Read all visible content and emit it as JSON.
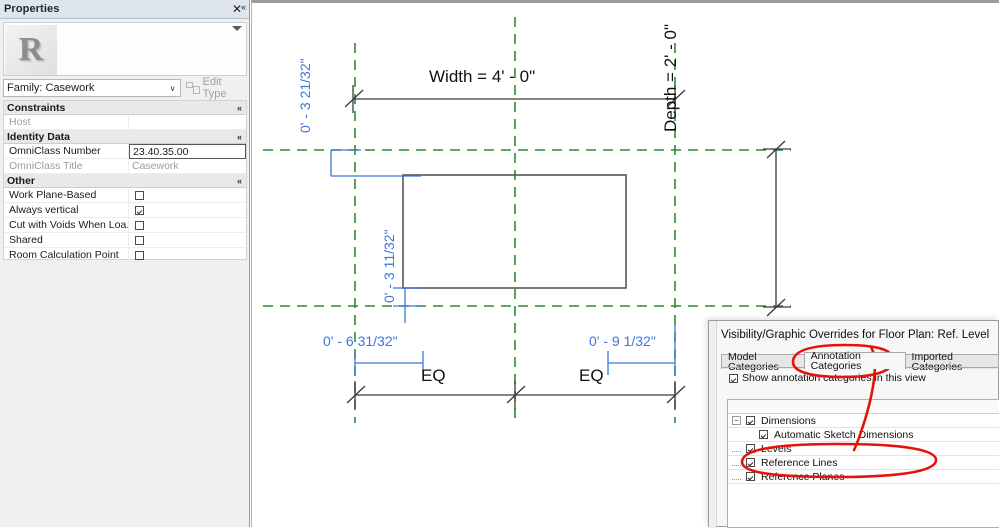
{
  "properties_panel": {
    "title": "Properties",
    "close_label": "✕",
    "collapse_label": "«",
    "thumbnail_letter": "R",
    "family_value": "Family: Casework",
    "family_arrow": "∨",
    "edit_type_label": "Edit Type",
    "groups": [
      {
        "name": "Constraints",
        "chevron": "«",
        "rows": [
          {
            "label": "Host",
            "value": "",
            "type": "text",
            "dim": true,
            "editing": false
          }
        ]
      },
      {
        "name": "Identity Data",
        "chevron": "«",
        "rows": [
          {
            "label": "OmniClass Number",
            "value": "23.40.35.00",
            "type": "text",
            "dim": false,
            "editing": true
          },
          {
            "label": "OmniClass Title",
            "value": "Casework",
            "type": "text",
            "dim": true,
            "editing": false
          }
        ]
      },
      {
        "name": "Other",
        "chevron": "«",
        "rows": [
          {
            "label": "Work Plane-Based",
            "value": "",
            "type": "checkbox",
            "checked": false,
            "dim": false
          },
          {
            "label": "Always vertical",
            "value": "",
            "type": "checkbox",
            "checked": true,
            "dim": false
          },
          {
            "label": "Cut with Voids When Loa...",
            "value": "",
            "type": "checkbox",
            "checked": false,
            "dim": false
          },
          {
            "label": "Shared",
            "value": "",
            "type": "checkbox",
            "checked": false,
            "dim": false
          },
          {
            "label": "Room Calculation Point",
            "value": "",
            "type": "checkbox",
            "checked": false,
            "dim": false
          }
        ]
      }
    ]
  },
  "canvas": {
    "width_dimension": "Width = 4' - 0\"",
    "depth_dimension": "Depth = 2' - 0\"",
    "top_left_offset": "0' - 3 21/32\"",
    "bottom_left_offset": "0' - 3 11/32\"",
    "bottom_dim_left": "0' - 6 31/32\"",
    "bottom_dim_right": "0' - 9 1/32\"",
    "eq_left": "EQ",
    "eq_right": "EQ",
    "colors": {
      "reference_plane": "#2f8a32",
      "sketch_dimension": "#3c78d8",
      "permanent_dimension": "#3a3a3a",
      "geometry": "#565656",
      "annotation_red": "#e8120c"
    }
  },
  "vg_dialog": {
    "title": "Visibility/Graphic Overrides for Floor Plan: Ref. Level",
    "tabs": [
      {
        "label": "Model Categories",
        "selected": false
      },
      {
        "label": "Annotation Categories",
        "selected": true
      },
      {
        "label": "Imported Categories",
        "selected": false
      }
    ],
    "show_annotation_label": "Show annotation categories in this view",
    "show_annotation_checked": true,
    "tree": [
      {
        "label": "Dimensions",
        "checked": true,
        "level": 0,
        "expander": "−"
      },
      {
        "label": "Automatic Sketch Dimensions",
        "checked": true,
        "level": 1,
        "expander": ""
      },
      {
        "label": "Levels",
        "checked": true,
        "level": 0,
        "expander": ""
      },
      {
        "label": "Reference Lines",
        "checked": true,
        "level": 0,
        "expander": ""
      },
      {
        "label": "Reference Planes",
        "checked": true,
        "level": 0,
        "expander": ""
      }
    ]
  }
}
